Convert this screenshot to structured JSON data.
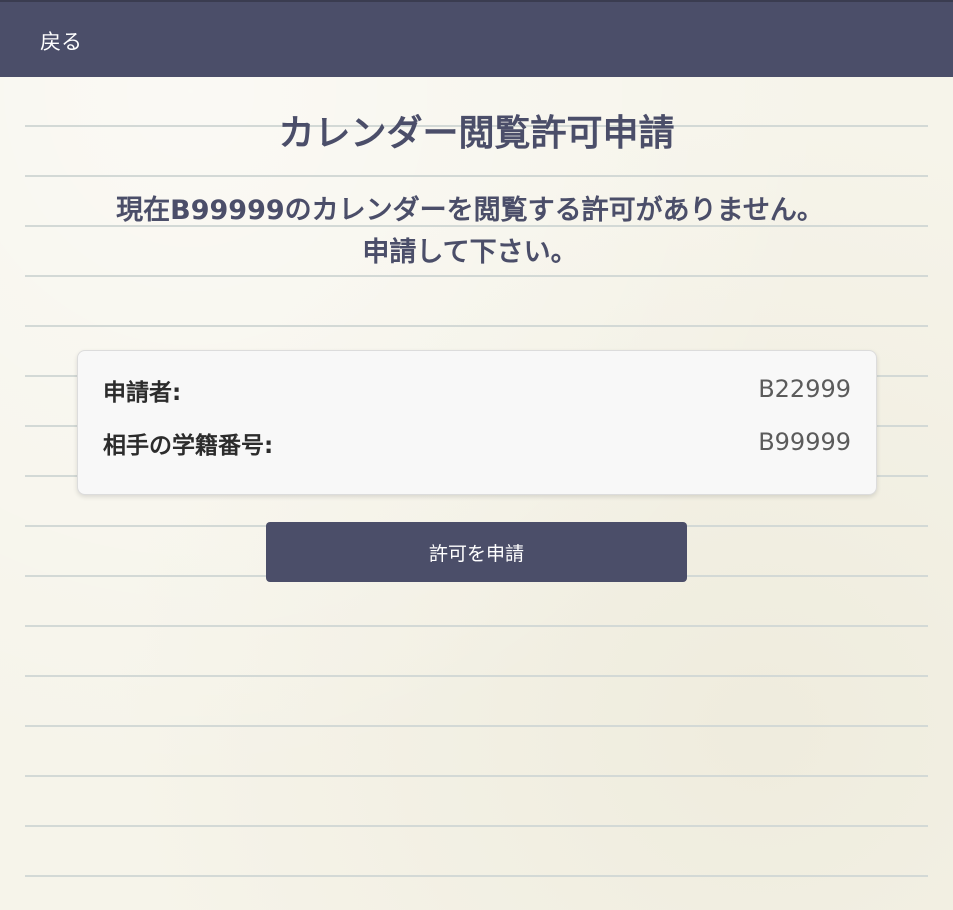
{
  "header": {
    "back_label": "戻る"
  },
  "main": {
    "title": "カレンダー閲覧許可申請",
    "message_line1": "現在B99999のカレンダーを閲覧する許可がありません。",
    "message_line2": "申請して下さい。"
  },
  "card": {
    "applicant_label": "申請者:",
    "applicant_value": "B22999",
    "target_label": "相手の学籍番号:",
    "target_value": "B99999"
  },
  "actions": {
    "submit_label": "許可を申請"
  },
  "colors": {
    "primary": "#4b4e69",
    "paper": "#f6f4ea",
    "ruled_line": "#d3d9d6",
    "card_bg": "#f8f8f8"
  }
}
